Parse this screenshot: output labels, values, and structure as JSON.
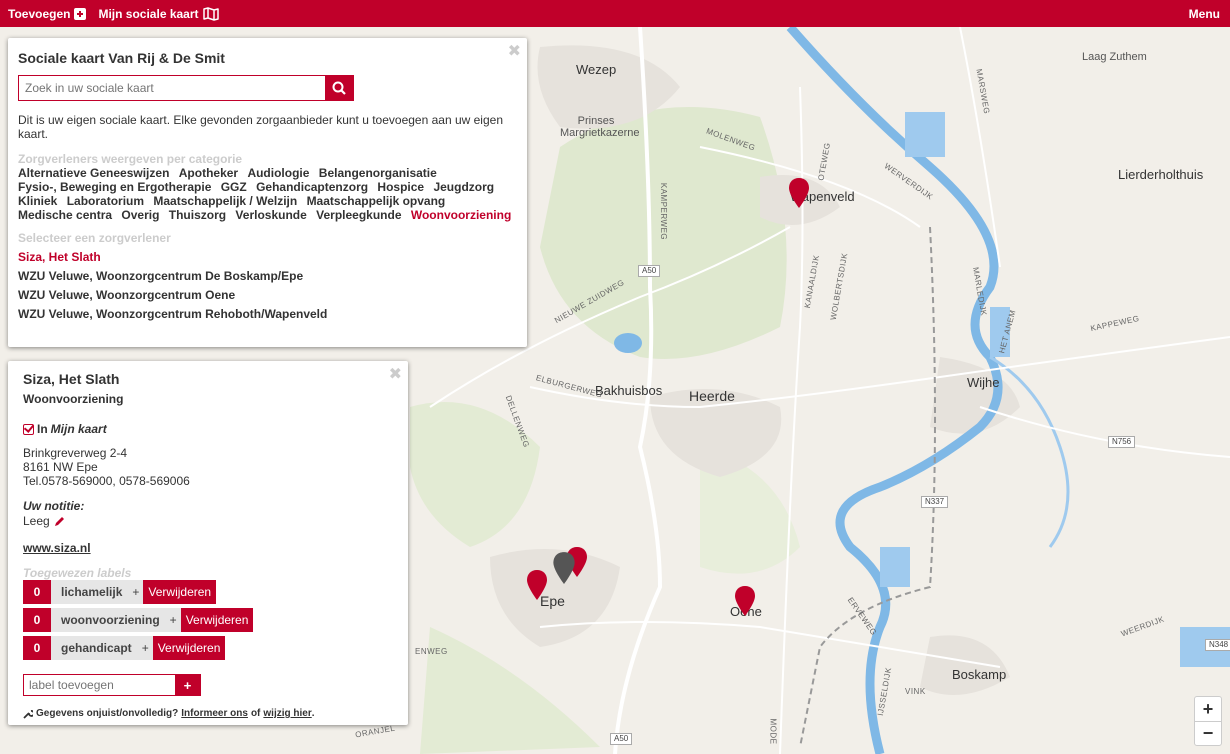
{
  "topbar": {
    "add_label": "Toevoegen",
    "mymap_label": "Mijn sociale kaart",
    "menu_label": "Menu"
  },
  "map": {
    "places": [
      "Wezep",
      "Laag Zuthem",
      "Prinses Margrietkazerne",
      "Wapenveld",
      "Lierderholthuis",
      "Heerde",
      "Bakhuisbos",
      "Wijhe",
      "Epe",
      "Oene",
      "Boskamp"
    ],
    "roads": [
      "MOLENWEG",
      "WERVERDIJK",
      "KAMPERWEG",
      "NIEUWE ZUIDWEG",
      "ELBURGERWEG",
      "DELLENWEG",
      "KANAALDIJK",
      "WOLBERTSDIJK",
      "MARLEDIJK",
      "HET ANEM",
      "KAPPEWEG",
      "ERVEWEG",
      "VINK",
      "WEERDIJK",
      "A50",
      "A50",
      "N337",
      "N756",
      "N348",
      "MARSWEG",
      "OTEWEG",
      "IJSSELDIJK",
      "MODE",
      "ORANJEL",
      "ENWEG"
    ]
  },
  "sidebar": {
    "title": "Sociale kaart Van Rij & De Smit",
    "search_placeholder": "Zoek in uw sociale kaart",
    "intro": "Dit is uw eigen sociale kaart. Elke gevonden zorgaanbieder kunt u toevoegen aan uw eigen kaart.",
    "categories_label": "Zorgverleners weergeven per categorie",
    "categories": [
      "Alternatieve Geneeswijzen",
      "Apotheker",
      "Audiologie",
      "Belangenorganisatie",
      "Fysio-, Beweging en Ergotherapie",
      "GGZ",
      "Gehandicaptenzorg",
      "Hospice",
      "Jeugdzorg",
      "Kliniek",
      "Laboratorium",
      "Maatschappelijk / Welzijn",
      "Maatschappelijk opvang",
      "Medische centra",
      "Overig",
      "Thuiszorg",
      "Verloskunde",
      "Verpleegkunde",
      "Woonvoorziening"
    ],
    "active_category": "Woonvoorziening",
    "providers_label": "Selecteer een zorgverlener",
    "providers": [
      "Siza, Het Slath",
      "WZU Veluwe, Woonzorgcentrum De Boskamp/Epe",
      "WZU Veluwe, Woonzorgcentrum Oene",
      "WZU Veluwe, Woonzorgcentrum Rehoboth/Wapenveld"
    ]
  },
  "detail": {
    "name": "Siza, Het Slath",
    "type": "Woonvoorziening",
    "in_label": "In",
    "in_map": "Mijn kaart",
    "address1": "Brinkgreverweg 2-4",
    "address2": "8161 NW Epe",
    "phone": "Tel.0578-569000, 0578-569006",
    "note_label": "Uw notitie:",
    "note": "Leeg",
    "website": "www.siza.nl",
    "labels_title": "Toegewezen labels",
    "labels": [
      {
        "count": "0",
        "name": "lichamelijk",
        "plus": "+",
        "remove": "Verwijderen"
      },
      {
        "count": "0",
        "name": "woonvoorziening",
        "plus": "+",
        "remove": "Verwijderen"
      },
      {
        "count": "0",
        "name": "gehandicapt",
        "plus": "+",
        "remove": "Verwijderen"
      }
    ],
    "add_label_placeholder": "label toevoegen",
    "add_label_button": "+",
    "footer_text": "Gegevens onjuist/onvolledig?",
    "footer_link1": "Informeer ons",
    "footer_of": "of",
    "footer_link2": "wijzig hier",
    "footer_end": "."
  },
  "zoom": {
    "in": "+",
    "out": "−"
  },
  "colors": {
    "brand": "#c0002a",
    "water": "#7fb8e6",
    "map_bg": "#f2efe9",
    "green": "#dce9c8"
  }
}
